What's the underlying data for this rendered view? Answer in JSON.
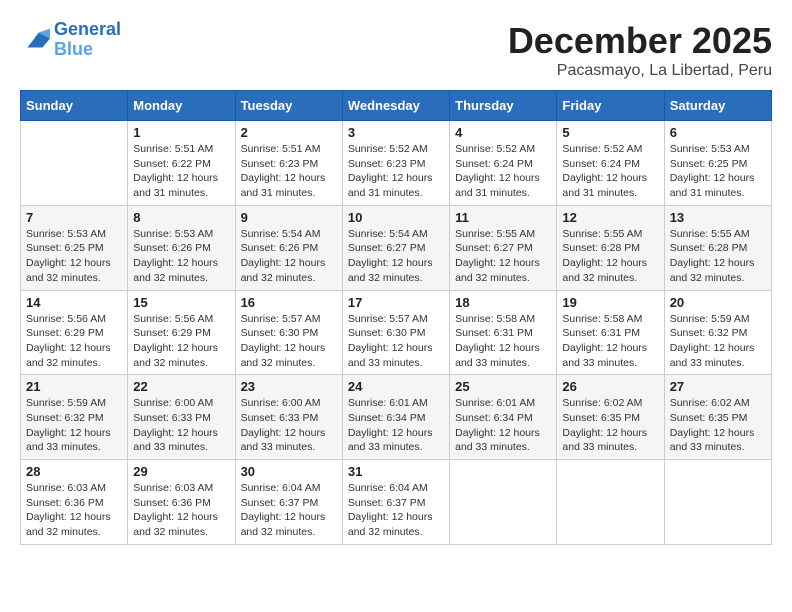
{
  "logo": {
    "line1": "General",
    "line2": "Blue"
  },
  "title": "December 2025",
  "location": "Pacasmayo, La Libertad, Peru",
  "weekdays": [
    "Sunday",
    "Monday",
    "Tuesday",
    "Wednesday",
    "Thursday",
    "Friday",
    "Saturday"
  ],
  "weeks": [
    [
      {
        "day": "",
        "info": ""
      },
      {
        "day": "1",
        "info": "Sunrise: 5:51 AM\nSunset: 6:22 PM\nDaylight: 12 hours\nand 31 minutes."
      },
      {
        "day": "2",
        "info": "Sunrise: 5:51 AM\nSunset: 6:23 PM\nDaylight: 12 hours\nand 31 minutes."
      },
      {
        "day": "3",
        "info": "Sunrise: 5:52 AM\nSunset: 6:23 PM\nDaylight: 12 hours\nand 31 minutes."
      },
      {
        "day": "4",
        "info": "Sunrise: 5:52 AM\nSunset: 6:24 PM\nDaylight: 12 hours\nand 31 minutes."
      },
      {
        "day": "5",
        "info": "Sunrise: 5:52 AM\nSunset: 6:24 PM\nDaylight: 12 hours\nand 31 minutes."
      },
      {
        "day": "6",
        "info": "Sunrise: 5:53 AM\nSunset: 6:25 PM\nDaylight: 12 hours\nand 31 minutes."
      }
    ],
    [
      {
        "day": "7",
        "info": "Sunrise: 5:53 AM\nSunset: 6:25 PM\nDaylight: 12 hours\nand 32 minutes."
      },
      {
        "day": "8",
        "info": "Sunrise: 5:53 AM\nSunset: 6:26 PM\nDaylight: 12 hours\nand 32 minutes."
      },
      {
        "day": "9",
        "info": "Sunrise: 5:54 AM\nSunset: 6:26 PM\nDaylight: 12 hours\nand 32 minutes."
      },
      {
        "day": "10",
        "info": "Sunrise: 5:54 AM\nSunset: 6:27 PM\nDaylight: 12 hours\nand 32 minutes."
      },
      {
        "day": "11",
        "info": "Sunrise: 5:55 AM\nSunset: 6:27 PM\nDaylight: 12 hours\nand 32 minutes."
      },
      {
        "day": "12",
        "info": "Sunrise: 5:55 AM\nSunset: 6:28 PM\nDaylight: 12 hours\nand 32 minutes."
      },
      {
        "day": "13",
        "info": "Sunrise: 5:55 AM\nSunset: 6:28 PM\nDaylight: 12 hours\nand 32 minutes."
      }
    ],
    [
      {
        "day": "14",
        "info": "Sunrise: 5:56 AM\nSunset: 6:29 PM\nDaylight: 12 hours\nand 32 minutes."
      },
      {
        "day": "15",
        "info": "Sunrise: 5:56 AM\nSunset: 6:29 PM\nDaylight: 12 hours\nand 32 minutes."
      },
      {
        "day": "16",
        "info": "Sunrise: 5:57 AM\nSunset: 6:30 PM\nDaylight: 12 hours\nand 32 minutes."
      },
      {
        "day": "17",
        "info": "Sunrise: 5:57 AM\nSunset: 6:30 PM\nDaylight: 12 hours\nand 33 minutes."
      },
      {
        "day": "18",
        "info": "Sunrise: 5:58 AM\nSunset: 6:31 PM\nDaylight: 12 hours\nand 33 minutes."
      },
      {
        "day": "19",
        "info": "Sunrise: 5:58 AM\nSunset: 6:31 PM\nDaylight: 12 hours\nand 33 minutes."
      },
      {
        "day": "20",
        "info": "Sunrise: 5:59 AM\nSunset: 6:32 PM\nDaylight: 12 hours\nand 33 minutes."
      }
    ],
    [
      {
        "day": "21",
        "info": "Sunrise: 5:59 AM\nSunset: 6:32 PM\nDaylight: 12 hours\nand 33 minutes."
      },
      {
        "day": "22",
        "info": "Sunrise: 6:00 AM\nSunset: 6:33 PM\nDaylight: 12 hours\nand 33 minutes."
      },
      {
        "day": "23",
        "info": "Sunrise: 6:00 AM\nSunset: 6:33 PM\nDaylight: 12 hours\nand 33 minutes."
      },
      {
        "day": "24",
        "info": "Sunrise: 6:01 AM\nSunset: 6:34 PM\nDaylight: 12 hours\nand 33 minutes."
      },
      {
        "day": "25",
        "info": "Sunrise: 6:01 AM\nSunset: 6:34 PM\nDaylight: 12 hours\nand 33 minutes."
      },
      {
        "day": "26",
        "info": "Sunrise: 6:02 AM\nSunset: 6:35 PM\nDaylight: 12 hours\nand 33 minutes."
      },
      {
        "day": "27",
        "info": "Sunrise: 6:02 AM\nSunset: 6:35 PM\nDaylight: 12 hours\nand 33 minutes."
      }
    ],
    [
      {
        "day": "28",
        "info": "Sunrise: 6:03 AM\nSunset: 6:36 PM\nDaylight: 12 hours\nand 32 minutes."
      },
      {
        "day": "29",
        "info": "Sunrise: 6:03 AM\nSunset: 6:36 PM\nDaylight: 12 hours\nand 32 minutes."
      },
      {
        "day": "30",
        "info": "Sunrise: 6:04 AM\nSunset: 6:37 PM\nDaylight: 12 hours\nand 32 minutes."
      },
      {
        "day": "31",
        "info": "Sunrise: 6:04 AM\nSunset: 6:37 PM\nDaylight: 12 hours\nand 32 minutes."
      },
      {
        "day": "",
        "info": ""
      },
      {
        "day": "",
        "info": ""
      },
      {
        "day": "",
        "info": ""
      }
    ]
  ]
}
